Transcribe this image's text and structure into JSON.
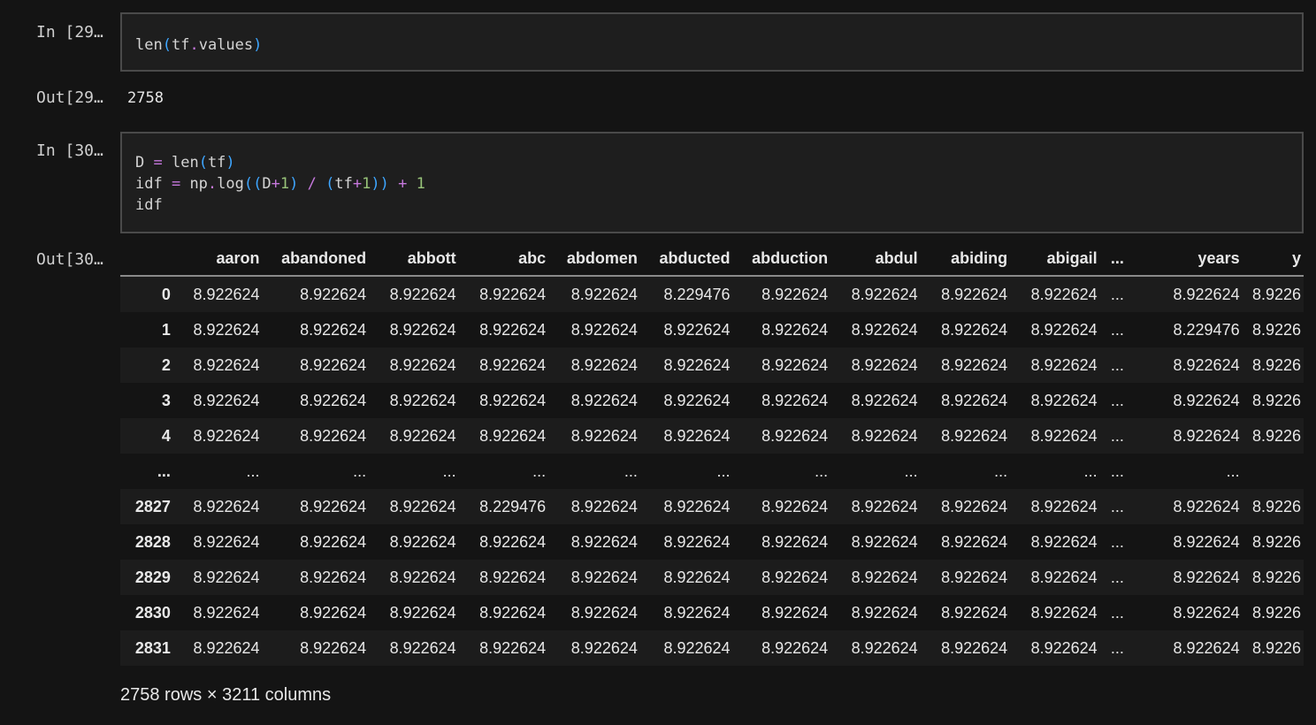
{
  "cells": [
    {
      "in_prompt": "In [29…",
      "code_lines": [
        [
          [
            "len",
            "t"
          ],
          [
            "(",
            "p"
          ],
          [
            "tf",
            "t"
          ],
          [
            ".",
            "o"
          ],
          [
            "values",
            "t"
          ],
          [
            ")",
            "p"
          ]
        ]
      ],
      "out_prompt": "Out[29…",
      "output": "2758"
    },
    {
      "in_prompt": "In [30…",
      "code_lines": [
        [
          [
            "D ",
            "t"
          ],
          [
            "=",
            "o"
          ],
          [
            " len",
            "t"
          ],
          [
            "(",
            "p"
          ],
          [
            "tf",
            "t"
          ],
          [
            ")",
            "p"
          ]
        ],
        [
          [
            "idf ",
            "t"
          ],
          [
            "=",
            "o"
          ],
          [
            " np",
            "t"
          ],
          [
            ".",
            "o"
          ],
          [
            "log",
            "t"
          ],
          [
            "((",
            "p"
          ],
          [
            "D",
            "t"
          ],
          [
            "+",
            "o"
          ],
          [
            "1",
            "n"
          ],
          [
            ")",
            "p"
          ],
          [
            " ",
            "t"
          ],
          [
            "/",
            "o"
          ],
          [
            " ",
            "t"
          ],
          [
            "(",
            "p"
          ],
          [
            "tf",
            "t"
          ],
          [
            "+",
            "o"
          ],
          [
            "1",
            "n"
          ],
          [
            "))",
            "p"
          ],
          [
            " ",
            "t"
          ],
          [
            "+",
            "o"
          ],
          [
            " ",
            "t"
          ],
          [
            "1",
            "n"
          ]
        ],
        [
          [
            "idf",
            "t"
          ]
        ]
      ],
      "out_prompt": "Out[30…"
    }
  ],
  "dataframe": {
    "columns": [
      "aaron",
      "abandoned",
      "abbott",
      "abc",
      "abdomen",
      "abducted",
      "abduction",
      "abdul",
      "abiding",
      "abigail",
      "...",
      "years",
      "y"
    ],
    "rows": [
      [
        "0",
        "8.922624",
        "8.922624",
        "8.922624",
        "8.922624",
        "8.922624",
        "8.229476",
        "8.922624",
        "8.922624",
        "8.922624",
        "8.922624",
        "...",
        "8.922624",
        "8.9226"
      ],
      [
        "1",
        "8.922624",
        "8.922624",
        "8.922624",
        "8.922624",
        "8.922624",
        "8.922624",
        "8.922624",
        "8.922624",
        "8.922624",
        "8.922624",
        "...",
        "8.229476",
        "8.9226"
      ],
      [
        "2",
        "8.922624",
        "8.922624",
        "8.922624",
        "8.922624",
        "8.922624",
        "8.922624",
        "8.922624",
        "8.922624",
        "8.922624",
        "8.922624",
        "...",
        "8.922624",
        "8.9226"
      ],
      [
        "3",
        "8.922624",
        "8.922624",
        "8.922624",
        "8.922624",
        "8.922624",
        "8.922624",
        "8.922624",
        "8.922624",
        "8.922624",
        "8.922624",
        "...",
        "8.922624",
        "8.9226"
      ],
      [
        "4",
        "8.922624",
        "8.922624",
        "8.922624",
        "8.922624",
        "8.922624",
        "8.922624",
        "8.922624",
        "8.922624",
        "8.922624",
        "8.922624",
        "...",
        "8.922624",
        "8.9226"
      ],
      [
        "...",
        "...",
        "...",
        "...",
        "...",
        "...",
        "...",
        "...",
        "...",
        "...",
        "...",
        "...",
        "...",
        ""
      ],
      [
        "2827",
        "8.922624",
        "8.922624",
        "8.922624",
        "8.229476",
        "8.922624",
        "8.922624",
        "8.922624",
        "8.922624",
        "8.922624",
        "8.922624",
        "...",
        "8.922624",
        "8.9226"
      ],
      [
        "2828",
        "8.922624",
        "8.922624",
        "8.922624",
        "8.922624",
        "8.922624",
        "8.922624",
        "8.922624",
        "8.922624",
        "8.922624",
        "8.922624",
        "...",
        "8.922624",
        "8.9226"
      ],
      [
        "2829",
        "8.922624",
        "8.922624",
        "8.922624",
        "8.922624",
        "8.922624",
        "8.922624",
        "8.922624",
        "8.922624",
        "8.922624",
        "8.922624",
        "...",
        "8.922624",
        "8.9226"
      ],
      [
        "2830",
        "8.922624",
        "8.922624",
        "8.922624",
        "8.922624",
        "8.922624",
        "8.922624",
        "8.922624",
        "8.922624",
        "8.922624",
        "8.922624",
        "...",
        "8.922624",
        "8.9226"
      ],
      [
        "2831",
        "8.922624",
        "8.922624",
        "8.922624",
        "8.922624",
        "8.922624",
        "8.922624",
        "8.922624",
        "8.922624",
        "8.922624",
        "8.922624",
        "...",
        "8.922624",
        "8.9226"
      ]
    ],
    "shape": "2758 rows × 3211 columns"
  },
  "colors": {
    "background": "#141414",
    "cell_border": "#4a4a4a",
    "paren": "#3ea6ff",
    "operator": "#c678dd",
    "number": "#98c379"
  }
}
